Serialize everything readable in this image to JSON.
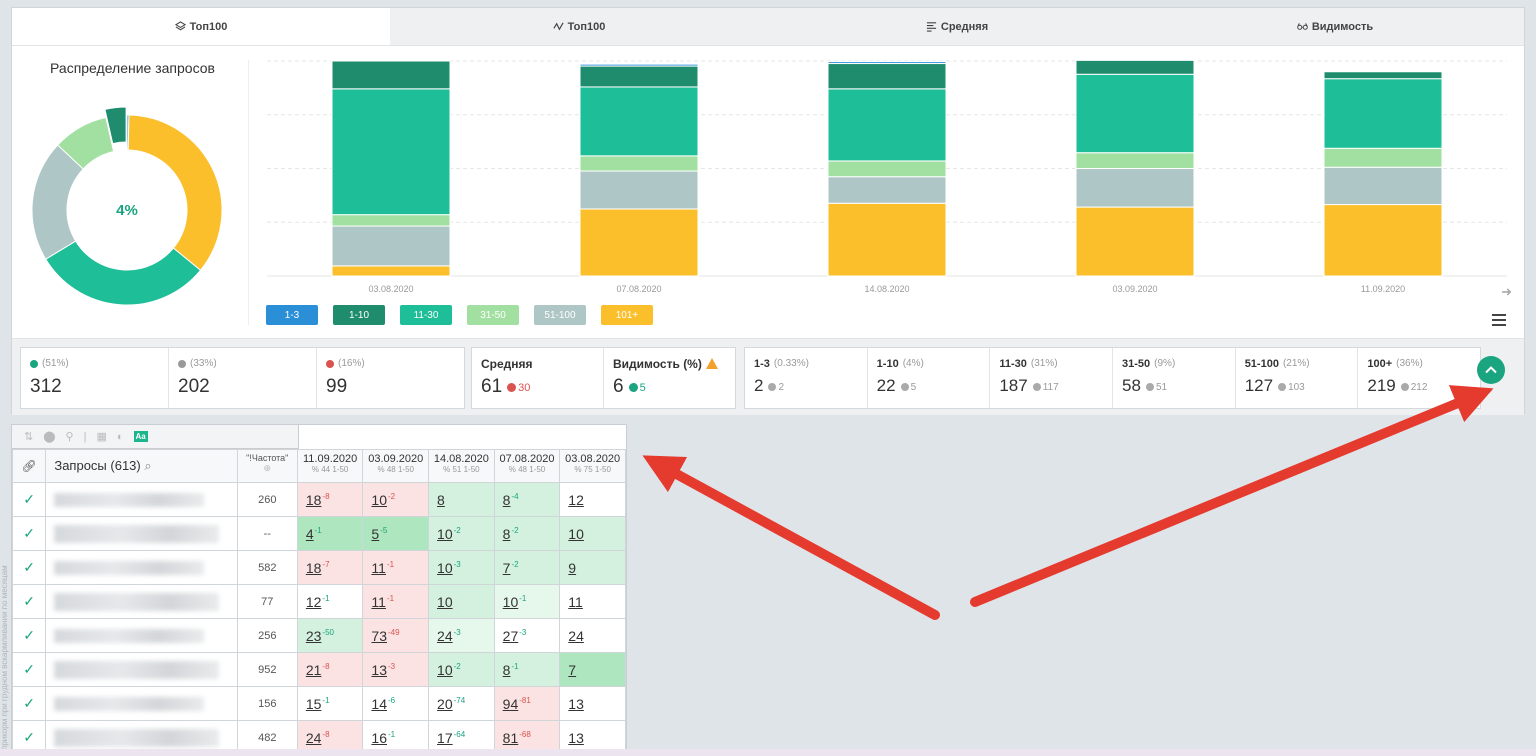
{
  "tabs": [
    {
      "label": "Топ100",
      "icon": "layers-icon"
    },
    {
      "label": "Топ100",
      "icon": "activity-icon"
    },
    {
      "label": "Средняя",
      "icon": "list-icon"
    },
    {
      "label": "Видимость",
      "icon": "glasses-icon"
    }
  ],
  "donut": {
    "title": "Распределение запросов",
    "center": "4%",
    "center_color": "#1aa47f"
  },
  "chart_data": {
    "type": "bar",
    "stacked": true,
    "categories": [
      "03.08.2020",
      "07.08.2020",
      "14.08.2020",
      "03.09.2020",
      "11.09.2020"
    ],
    "series": [
      {
        "name": "101+",
        "color": "#fbbf2c",
        "values": [
          16,
          106,
          115,
          109,
          113
        ]
      },
      {
        "name": "51-100",
        "color": "#afc6c6",
        "values": [
          63,
          60,
          42,
          61,
          59
        ]
      },
      {
        "name": "31-50",
        "color": "#a2e0a1",
        "values": [
          18,
          24,
          25,
          25,
          30
        ]
      },
      {
        "name": "11-30",
        "color": "#1dbe98",
        "values": [
          199,
          109,
          114,
          124,
          110
        ]
      },
      {
        "name": "1-10",
        "color": "#1f8d6d",
        "values": [
          44,
          33,
          40,
          22,
          11
        ]
      },
      {
        "name": "1-3",
        "color": "#2b8fd8",
        "values": [
          0,
          3,
          3,
          0,
          0
        ]
      }
    ],
    "grid": true,
    "legend": "bottom"
  },
  "legend": [
    {
      "label": "1-3",
      "bg": "#2b8fd8",
      "fg": "#ffffff"
    },
    {
      "label": "1-10",
      "bg": "#1f8d6d",
      "fg": "#ffffff"
    },
    {
      "label": "11-30",
      "bg": "#1dbe98",
      "fg": "#ffffff"
    },
    {
      "label": "31-50",
      "bg": "#a2e0a1",
      "fg": "#ffffff"
    },
    {
      "label": "51-100",
      "bg": "#afc6c6",
      "fg": "#ffffff"
    },
    {
      "label": "101+",
      "bg": "#fbbf2c",
      "fg": "#ffffff"
    }
  ],
  "summary": {
    "up": {
      "pct": "(51%)",
      "value": "312"
    },
    "same": {
      "pct": "(33%)",
      "value": "202"
    },
    "down": {
      "pct": "(16%)",
      "value": "99"
    }
  },
  "avg": {
    "label": "Средняя",
    "value": "61",
    "delta": "30"
  },
  "vis": {
    "label": "Видимость (%)",
    "value": "6",
    "delta": "5"
  },
  "ranges": [
    {
      "label": "1-3",
      "pct": "(0.33%)",
      "value": "2",
      "delta": "2"
    },
    {
      "label": "1-10",
      "pct": "(4%)",
      "value": "22",
      "delta": "5"
    },
    {
      "label": "11-30",
      "pct": "(31%)",
      "value": "187",
      "delta": "117"
    },
    {
      "label": "31-50",
      "pct": "(9%)",
      "value": "58",
      "delta": "51"
    },
    {
      "label": "51-100",
      "pct": "(21%)",
      "value": "127",
      "delta": "103"
    },
    {
      "label": "100+",
      "pct": "(36%)",
      "value": "219",
      "delta": "212"
    }
  ],
  "table": {
    "queries_label": "Запросы (613)",
    "freq_label": "\"!Частота\"",
    "dates": [
      {
        "date": "11.09.2020",
        "sub": "44",
        "range": "1-50"
      },
      {
        "date": "03.09.2020",
        "sub": "48",
        "range": "1-50"
      },
      {
        "date": "14.08.2020",
        "sub": "51",
        "range": "1-50"
      },
      {
        "date": "07.08.2020",
        "sub": "48",
        "range": "1-50"
      },
      {
        "date": "03.08.2020",
        "sub": "75",
        "range": "1-50"
      }
    ],
    "rows": [
      {
        "freq": "260",
        "cells": [
          {
            "v": "18",
            "d": "-8",
            "c": "r"
          },
          {
            "v": "10",
            "d": "-2",
            "c": "r"
          },
          {
            "v": "8",
            "d": "",
            "c": "g"
          },
          {
            "v": "8",
            "d": "-4",
            "c": "g"
          },
          {
            "v": "12",
            "d": "",
            "c": ""
          }
        ]
      },
      {
        "freq": "--",
        "cells": [
          {
            "v": "4",
            "d": "-1",
            "c": "G"
          },
          {
            "v": "5",
            "d": "-5",
            "c": "G"
          },
          {
            "v": "10",
            "d": "-2",
            "c": "g"
          },
          {
            "v": "8",
            "d": "-2",
            "c": "g"
          },
          {
            "v": "10",
            "d": "",
            "c": "g"
          }
        ]
      },
      {
        "freq": "582",
        "cells": [
          {
            "v": "18",
            "d": "-7",
            "c": "r"
          },
          {
            "v": "11",
            "d": "-1",
            "c": "r"
          },
          {
            "v": "10",
            "d": "-3",
            "c": "g"
          },
          {
            "v": "7",
            "d": "-2",
            "c": "g"
          },
          {
            "v": "9",
            "d": "",
            "c": "g"
          }
        ]
      },
      {
        "freq": "77",
        "cells": [
          {
            "v": "12",
            "d": "-1",
            "c": ""
          },
          {
            "v": "11",
            "d": "-1",
            "c": "r"
          },
          {
            "v": "10",
            "d": "",
            "c": "g"
          },
          {
            "v": "10",
            "d": "-1",
            "c": "l"
          },
          {
            "v": "11",
            "d": "",
            "c": ""
          }
        ]
      },
      {
        "freq": "256",
        "cells": [
          {
            "v": "23",
            "d": "-50",
            "c": "g"
          },
          {
            "v": "73",
            "d": "-49",
            "c": "r"
          },
          {
            "v": "24",
            "d": "-3",
            "c": "l"
          },
          {
            "v": "27",
            "d": "-3",
            "c": ""
          },
          {
            "v": "24",
            "d": "",
            "c": ""
          }
        ]
      },
      {
        "freq": "952",
        "cells": [
          {
            "v": "21",
            "d": "-8",
            "c": "r"
          },
          {
            "v": "13",
            "d": "-3",
            "c": "r"
          },
          {
            "v": "10",
            "d": "-2",
            "c": "g"
          },
          {
            "v": "8",
            "d": "-1",
            "c": "g"
          },
          {
            "v": "7",
            "d": "",
            "c": "G"
          }
        ]
      },
      {
        "freq": "156",
        "cells": [
          {
            "v": "15",
            "d": "-1",
            "c": ""
          },
          {
            "v": "14",
            "d": "-6",
            "c": ""
          },
          {
            "v": "20",
            "d": "-74",
            "c": ""
          },
          {
            "v": "94",
            "d": "-81",
            "c": "r"
          },
          {
            "v": "13",
            "d": "",
            "c": ""
          }
        ]
      },
      {
        "freq": "482",
        "cells": [
          {
            "v": "24",
            "d": "-8",
            "c": "r"
          },
          {
            "v": "16",
            "d": "-1",
            "c": ""
          },
          {
            "v": "17",
            "d": "-64",
            "c": ""
          },
          {
            "v": "81",
            "d": "-68",
            "c": "r"
          },
          {
            "v": "13",
            "d": "",
            "c": ""
          }
        ]
      }
    ]
  },
  "side_text": "прикорм при грудном вскармливании по месяцам"
}
